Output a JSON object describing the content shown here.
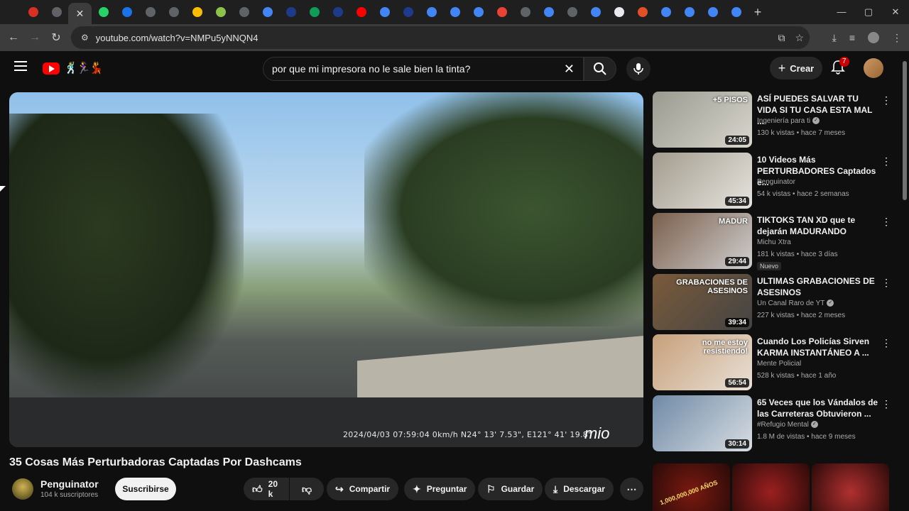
{
  "browser": {
    "url": "youtube.com/watch?v=NMPu5yNNQN4",
    "tab_favicons": [
      "#d93025",
      "#5f6368",
      "#e8eaed",
      "#25d366",
      "#1a73e8",
      "#5f6368",
      "#5f6368",
      "#fbbc04",
      "#8bc34a",
      "#5f6368",
      "#4285f4",
      "#1e3a8a",
      "#0f9d58",
      "#1e3a8a",
      "#ff0000",
      "#4285f4",
      "#1e3a8a",
      "#4285f4",
      "#4285f4",
      "#4285f4",
      "#ea4335",
      "#5f6368",
      "#4285f4",
      "#5f6368",
      "#4285f4",
      "#e8eaed",
      "#e34f26",
      "#4285f4",
      "#4285f4",
      "#4285f4",
      "#4285f4"
    ],
    "active_tab_close": "✕",
    "new_tab": "+"
  },
  "header": {
    "search_query": "por que mi impresora no le sale bien la tinta?",
    "create_label": "Crear",
    "notifications_count": "7",
    "logo_doodle": "🕺🏃‍♀️💃"
  },
  "video": {
    "title": "35 Cosas Más Perturbadoras Captadas Por Dashcams",
    "dashcam_stamp": "2024/04/03  07:59:04 0km/h   N24° 13' 7.53\",  E121° 41' 19.8\"",
    "dashcam_brand": "mio",
    "channel": {
      "name": "Penguinator",
      "subscribers": "104 k suscriptores",
      "subscribe_label": "Suscribirse"
    },
    "actions": {
      "likes": "20 k",
      "share": "Compartir",
      "ask": "Preguntar",
      "save": "Guardar",
      "download": "Descargar"
    }
  },
  "recommendations": [
    {
      "title": "ASÍ PUEDES SALVAR TU VIDA SI TU CASA ESTA MAL ...",
      "channel": "Ingeniería para ti",
      "verified": true,
      "meta": "130 k vistas • hace 7 meses",
      "duration": "24:05",
      "thumb_text": "+5 PISOS",
      "color_a": "#9a9a8f",
      "color_b": "#d8d6cd"
    },
    {
      "title": "10 Videos Más PERTURBADORES Captados e...",
      "channel": "Penguinator",
      "verified": false,
      "meta": "54 k vistas • hace 2 semanas",
      "duration": "45:34",
      "thumb_text": "",
      "color_a": "#a39c8e",
      "color_b": "#e6e4de"
    },
    {
      "title": "TIKTOKS TAN XD que te dejarán MADURANDO",
      "channel": "Michu Xtra",
      "verified": false,
      "meta": "181 k vistas • hace 3 días",
      "duration": "29:44",
      "thumb_text": "MADUR",
      "new_badge": "Nuevo",
      "color_a": "#7b5f4c",
      "color_b": "#cfcfcf"
    },
    {
      "title": "ULTIMAS GRABACIONES DE ASESINOS",
      "channel": "Un Canal Raro de YT",
      "verified": true,
      "meta": "227 k vistas • hace 2 meses",
      "duration": "39:34",
      "thumb_text": "GRABACIONES DE ASESINOS",
      "color_a": "#7a5a3a",
      "color_b": "#444"
    },
    {
      "title": "Cuando Los Policías Sirven KARMA INSTANTÁNEO A ...",
      "channel": "Mente Policial",
      "verified": false,
      "meta": "528 k vistas • hace 1 año",
      "duration": "56:54",
      "thumb_text": "no me estoy resistiendo!",
      "color_a": "#c7a07a",
      "color_b": "#e9e0d6"
    },
    {
      "title": "65 Veces que los Vándalos de las Carreteras Obtuvieron ...",
      "channel": "#Refugio Mental",
      "verified": true,
      "meta": "1.8 M de vistas • hace 9 meses",
      "duration": "30:14",
      "thumb_text": "",
      "color_a": "#6f8aa6",
      "color_b": "#d8dde2"
    }
  ],
  "shorts": [
    {
      "color": "#7a1a10",
      "text": "1,000,000,000 AÑOS"
    },
    {
      "color": "#9b2020",
      "text": ""
    },
    {
      "color": "#b03030",
      "text": ""
    }
  ]
}
